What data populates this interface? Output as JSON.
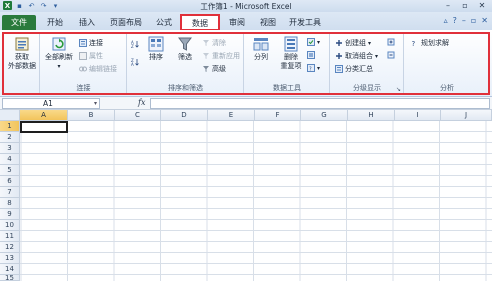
{
  "window": {
    "title": "工作簿1 - Microsoft Excel"
  },
  "tabs": {
    "file": "文件",
    "items": [
      "开始",
      "插入",
      "页面布局",
      "公式",
      "数据",
      "审阅",
      "视图",
      "开发工具"
    ],
    "active": "数据"
  },
  "ribbon": {
    "get_external": {
      "label_line1": "获取",
      "label_line2": "外部数据"
    },
    "connections_group": {
      "refresh_all": "全部刷新",
      "connect": "连接",
      "properties": "属性",
      "edit_links": "编辑链接",
      "label": "连接"
    },
    "sort_filter_group": {
      "sort": "排序",
      "filter": "筛选",
      "clear": "清除",
      "reapply": "重新应用",
      "advanced": "高级",
      "label": "排序和筛选"
    },
    "data_tools_group": {
      "text_to_columns": "分列",
      "remove_dup_line1": "删除",
      "remove_dup_line2": "重复项",
      "label": "数据工具"
    },
    "outline_group": {
      "group": "创建组",
      "ungroup": "取消组合",
      "subtotal": "分类汇总",
      "label": "分级显示"
    },
    "analysis_group": {
      "solver": "规划求解",
      "label": "分析"
    }
  },
  "formula_bar": {
    "name_box": "A1",
    "fx": "fx",
    "formula": ""
  },
  "grid": {
    "columns": [
      "A",
      "B",
      "C",
      "D",
      "E",
      "F",
      "G",
      "H",
      "I",
      "J"
    ],
    "rows": [
      "1",
      "2",
      "3",
      "4",
      "5",
      "6",
      "7",
      "8",
      "9",
      "10",
      "11",
      "12",
      "13",
      "14",
      "15"
    ],
    "active_cell": "A1"
  },
  "colors": {
    "file_tab": "#2a7a3c",
    "highlight": "#e0303a",
    "selected_header": "#f2c45c"
  }
}
